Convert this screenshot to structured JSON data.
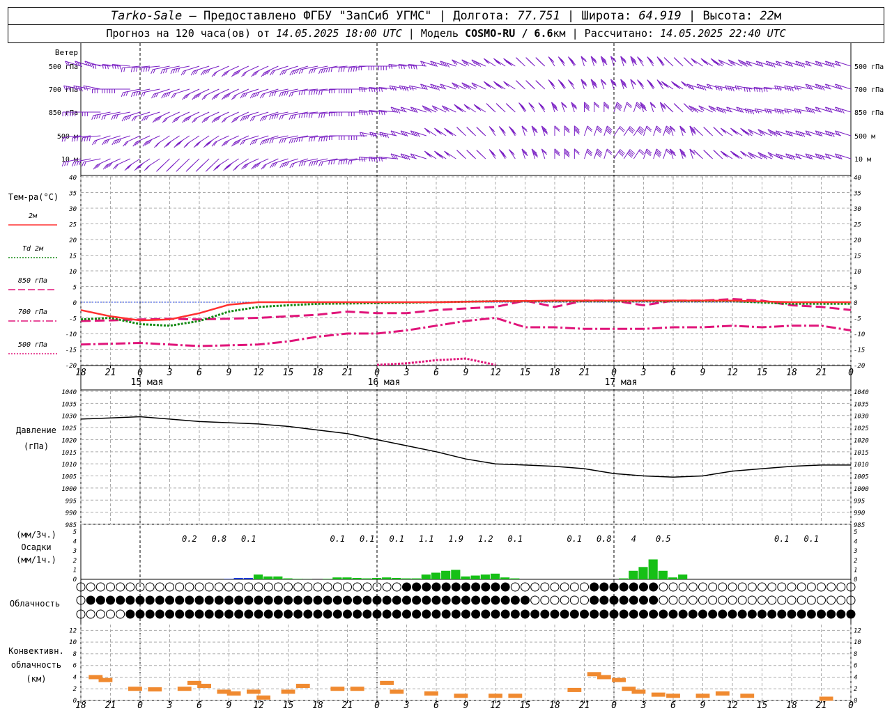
{
  "header": {
    "station": "Tarko-Sale",
    "sep1": " – ",
    "provider": "Предоставлено ФГБУ \"ЗапСиб УГМС\"",
    "lon_label": " | Долгота: ",
    "lon": "77.751",
    "lat_label": " | Широта: ",
    "lat": "64.919",
    "alt_label": " | Высота: ",
    "alt": "22",
    "alt_unit": "м",
    "forecast_prefix": "Прогноз на 120 часа(ов) от ",
    "forecast_time": "14.05.2025 18:00 UTC",
    "model_label": " | Модель ",
    "model": "COSMO-RU / 6.6",
    "model_unit": "км",
    "calc_label": " | Рассчитано: ",
    "calc_time": "14.05.2025 22:40 UTC"
  },
  "time_axis": {
    "ticks": [
      "18",
      "21",
      "0",
      "3",
      "6",
      "9",
      "12",
      "15",
      "18",
      "21",
      "0",
      "3",
      "6",
      "9",
      "12",
      "15",
      "18",
      "21",
      "0",
      "3",
      "6",
      "9",
      "12",
      "15",
      "18",
      "21",
      "0"
    ],
    "days": [
      "15 мая",
      "16 мая",
      "17 мая"
    ]
  },
  "wind_panel": {
    "title": "Ветер",
    "levels": [
      "500 гПа",
      "700 гПа",
      "850 гПа",
      "500 м",
      "10 м"
    ],
    "barb_color": "#7a1fc4"
  },
  "temp_panel": {
    "ylabel": "Тем-ра(°С)",
    "ylim": [
      -20,
      40
    ],
    "yticks": [
      "40",
      "35",
      "30",
      "25",
      "20",
      "15",
      "10",
      "5",
      "0",
      "-5",
      "-10",
      "-15",
      "-20"
    ],
    "legend": [
      {
        "label": "2м",
        "color": "#ff3030",
        "dash": "solid"
      },
      {
        "label": "Td 2м",
        "color": "#138a13",
        "dash": "dotted"
      },
      {
        "label": "850 гПа",
        "color": "#e0157a",
        "dash": "dashed"
      },
      {
        "label": "700 гПа",
        "color": "#e0157a",
        "dash": "dashdot"
      },
      {
        "label": "500 гПа",
        "color": "#e0157a",
        "dash": "dotted"
      }
    ]
  },
  "pressure_panel": {
    "ylabel1": "Давление",
    "ylabel2": "(гПа)",
    "ylim": [
      985,
      1040
    ],
    "yticks": [
      "1040",
      "1035",
      "1030",
      "1025",
      "1020",
      "1015",
      "1010",
      "1005",
      "1000",
      "995",
      "990",
      "985"
    ]
  },
  "precip_panel": {
    "unit3h": "(мм/3ч.)",
    "title": "Осадки",
    "unit1h": "(мм/1ч.)",
    "yticks": [
      "5",
      "4",
      "3",
      "2",
      "1",
      "0"
    ],
    "totals": [
      {
        "t": 11,
        "v": "0.2"
      },
      {
        "t": 14,
        "v": "0.8"
      },
      {
        "t": 17,
        "v": "0.1"
      },
      {
        "t": 26,
        "v": "0.1"
      },
      {
        "t": 29,
        "v": "0.1"
      },
      {
        "t": 32,
        "v": "0.1"
      },
      {
        "t": 35,
        "v": "1.1"
      },
      {
        "t": 38,
        "v": "1.9"
      },
      {
        "t": 41,
        "v": "1.2"
      },
      {
        "t": 44,
        "v": "0.1"
      },
      {
        "t": 50,
        "v": "0.1"
      },
      {
        "t": 53,
        "v": "0.8"
      },
      {
        "t": 56,
        "v": "4"
      },
      {
        "t": 59,
        "v": "0.5"
      },
      {
        "t": 71,
        "v": "0.1"
      },
      {
        "t": 74,
        "v": "0.1"
      }
    ]
  },
  "cloud_panel": {
    "title": "Облачность"
  },
  "conv_panel": {
    "title1": "Конвективн.",
    "title2": "облачность",
    "unit": "(км)",
    "yticks": [
      "12",
      "10",
      "8",
      "6",
      "4",
      "2",
      "0"
    ]
  },
  "chart_data": {
    "type": "line",
    "x_hours_from_start": "0..78 (14.05 18 UTC .. 18.05 00 UTC)",
    "temp_2m": {
      "x": [
        0,
        3,
        6,
        9,
        12,
        15,
        18,
        21,
        24,
        30,
        36,
        42,
        48,
        54,
        60,
        66,
        72,
        78
      ],
      "y": [
        -2.5,
        -4.5,
        -5.8,
        -5.5,
        -3.5,
        -0.8,
        0,
        0,
        0,
        0,
        0,
        0.3,
        0.5,
        0.5,
        0.5,
        0.5,
        0,
        0
      ]
    },
    "td_2m": {
      "x": [
        0,
        3,
        6,
        9,
        12,
        15,
        18,
        21,
        24,
        30,
        36,
        42,
        48,
        54,
        60,
        66,
        72,
        78
      ],
      "y": [
        -5.5,
        -5,
        -7,
        -7.5,
        -6,
        -3,
        -1.5,
        -1,
        -0.5,
        -0.3,
        0,
        0.3,
        0.3,
        0.3,
        0.3,
        0.3,
        -0.5,
        -0.5
      ]
    },
    "t_850": {
      "x": [
        0,
        3,
        6,
        9,
        12,
        18,
        24,
        27,
        30,
        33,
        36,
        39,
        42,
        45,
        48,
        51,
        54,
        57,
        60,
        63,
        66,
        69,
        72,
        75,
        78
      ],
      "y": [
        -6,
        -5.8,
        -5.5,
        -5.3,
        -5.5,
        -5,
        -4,
        -3,
        -3.5,
        -3.5,
        -2.5,
        -2,
        -1.5,
        0.5,
        -1.5,
        0.5,
        0.5,
        -1,
        0.5,
        0.5,
        1,
        0.5,
        -1,
        -1.5,
        -2.5
      ]
    },
    "t_700": {
      "x": [
        0,
        6,
        9,
        12,
        18,
        21,
        24,
        27,
        30,
        33,
        36,
        39,
        42,
        45,
        48,
        51,
        54,
        57,
        60,
        63,
        66,
        69,
        72,
        75,
        78
      ],
      "y": [
        -13.5,
        -13,
        -13.5,
        -14,
        -13.5,
        -12.5,
        -11,
        -10,
        -10,
        -9,
        -7.5,
        -6,
        -5,
        -8,
        -8,
        -8.5,
        -8.5,
        -8.5,
        -8,
        -8,
        -7.5,
        -8,
        -7.5,
        -7.5,
        -9
      ]
    },
    "t_500": {
      "x": [
        30,
        33,
        36,
        39,
        42
      ],
      "y": [
        -20,
        -19.5,
        -18.5,
        -18,
        -20
      ]
    },
    "pressure": {
      "x": [
        0,
        3,
        6,
        9,
        12,
        15,
        18,
        21,
        24,
        27,
        30,
        33,
        36,
        39,
        42,
        45,
        48,
        51,
        54,
        57,
        60,
        63,
        66,
        69,
        72,
        75,
        78
      ],
      "y": [
        1028.5,
        1029,
        1029.5,
        1028.5,
        1027.5,
        1027,
        1026.5,
        1025.5,
        1024,
        1022.5,
        1020,
        1017.5,
        1015,
        1012,
        1010,
        1009.5,
        1009,
        1008,
        1006,
        1005,
        1004.5,
        1005,
        1007,
        1008,
        1009,
        1009.5,
        1009.5
      ]
    },
    "precip_1h": {
      "x": [
        15,
        16,
        17,
        18,
        19,
        20,
        21,
        22,
        23,
        24,
        25,
        26,
        27,
        28,
        29,
        30,
        31,
        32,
        33,
        34,
        35,
        36,
        37,
        38,
        39,
        40,
        41,
        42,
        43,
        44,
        45,
        46,
        47,
        48,
        55,
        56,
        57,
        58,
        59,
        60,
        61,
        62,
        63,
        64
      ],
      "y": [
        0.05,
        0.15,
        0.15,
        0.5,
        0.3,
        0.3,
        0.1,
        0.05,
        0.02,
        0,
        0.05,
        0.2,
        0.2,
        0.15,
        0.1,
        0.15,
        0.2,
        0.15,
        0.1,
        0.1,
        0.5,
        0.7,
        0.9,
        1.0,
        0.3,
        0.4,
        0.5,
        0.6,
        0.2,
        0.1,
        0,
        0,
        0,
        0,
        0.1,
        0.9,
        1.3,
        2.1,
        0.9,
        0.2,
        0.5,
        0,
        0,
        0
      ]
    },
    "precip_series_colors": {
      "rain": "#16c016",
      "snow": "#1a3ad6"
    },
    "convective_base_km": {
      "x": [
        1.5,
        2.5,
        5.5,
        7.5,
        10.5,
        11.5,
        12.5,
        14.5,
        15.5,
        17.5,
        18.5,
        21,
        22.5,
        26,
        28,
        31,
        32,
        35.5,
        38.5,
        42,
        44,
        50,
        52,
        53,
        54.5,
        55.5,
        56.5,
        58.5,
        60,
        63,
        65,
        67.5,
        75.5
      ],
      "y": [
        4,
        3.5,
        2,
        1.9,
        2,
        3,
        2.5,
        1.5,
        1.2,
        1.5,
        0.5,
        1.5,
        2.5,
        2,
        2,
        3,
        1.5,
        1.2,
        0.8,
        0.8,
        0.8,
        1.8,
        4.5,
        4,
        3.5,
        2,
        1.5,
        1,
        0.8,
        0.8,
        1.2,
        0.8,
        0.3
      ]
    },
    "convective_color": "#f08a30"
  }
}
